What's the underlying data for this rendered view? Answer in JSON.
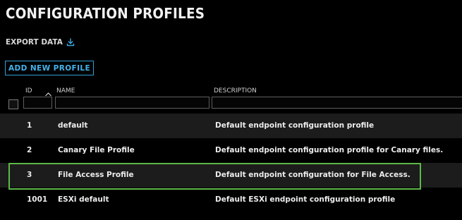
{
  "page": {
    "title": "CONFIGURATION PROFILES"
  },
  "toolbar": {
    "export_label": "EXPORT DATA",
    "export_icon": "download-icon",
    "add_label": "ADD NEW PROFILE"
  },
  "table": {
    "columns": {
      "id": "ID",
      "name": "NAME",
      "description": "DESCRIPTION"
    },
    "sort": {
      "column": "id",
      "direction": "ascending",
      "icon": "chevron-up-icon"
    },
    "rows": [
      {
        "id": "1",
        "name": "default",
        "description": "Default endpoint configuration profile"
      },
      {
        "id": "2",
        "name": "Canary File Profile",
        "description": "Default endpoint configuration profile for Canary files."
      },
      {
        "id": "3",
        "name": "File Access Profile",
        "description": "Default endpoint configuration for File Access."
      },
      {
        "id": "1001",
        "name": "ESXi default",
        "description": "Default ESXi endpoint configuration profile"
      }
    ],
    "highlighted_row": 2
  },
  "colors": {
    "accent": "#2f9fd6",
    "highlight": "#5db84a",
    "row_alt": "#1c1c1c",
    "background": "#000000"
  }
}
